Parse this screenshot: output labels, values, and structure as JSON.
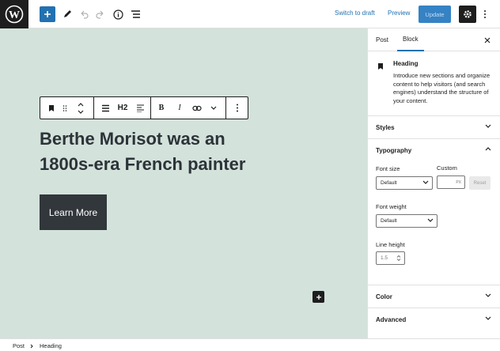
{
  "topbar": {
    "switch_to_draft": "Switch to draft",
    "preview": "Preview",
    "update": "Update"
  },
  "toolbar": {
    "heading_level": "H2"
  },
  "editor": {
    "heading_text": "Berthe Morisot was an 1800s-era French painter",
    "button_text": "Learn More"
  },
  "sidebar": {
    "tabs": [
      "Post",
      "Block"
    ],
    "active_tab": "Block",
    "block_card": {
      "title": "Heading",
      "description": "Introduce new sections and organize content to help visitors (and search engines) understand the structure of your content."
    },
    "panels": {
      "styles": "Styles",
      "typography": "Typography",
      "color": "Color",
      "advanced": "Advanced"
    },
    "typography": {
      "font_size_label": "Font size",
      "custom_label": "Custom",
      "font_size_value": "Default",
      "custom_unit": "PX",
      "reset": "Reset",
      "font_weight_label": "Font weight",
      "font_weight_value": "Default",
      "line_height_label": "Line height",
      "line_height_value": "1.5"
    }
  },
  "statusbar": {
    "breadcrumb": [
      "Post",
      "Heading"
    ]
  },
  "colors": {
    "canvas_bg": "#d3e2db",
    "accent": "#2271b1",
    "button_bg": "#32373c"
  }
}
